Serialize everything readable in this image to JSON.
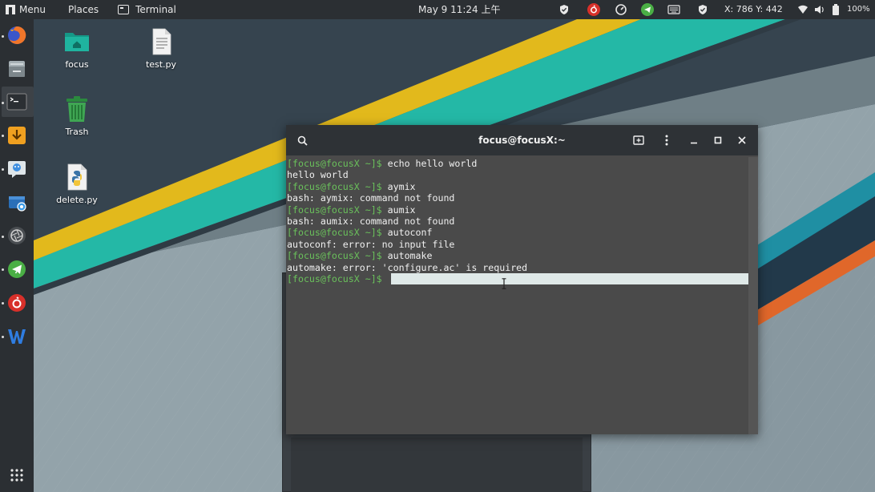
{
  "top_panel": {
    "menu_label": "Menu",
    "places_label": "Places",
    "terminal_label": "Terminal",
    "clock": "May 9  11:24 上午",
    "coords": "X: 786 Y: 442",
    "battery": "100%"
  },
  "desktop": {
    "icons": [
      {
        "label": "focus"
      },
      {
        "label": "test.py"
      },
      {
        "label": "Trash"
      },
      {
        "label": "delete.py"
      }
    ]
  },
  "terminal": {
    "title": "focus@focusX:~",
    "prompt": "[focus@focusX ~]$ ",
    "lines": [
      {
        "prompt": "[focus@focusX ~]$ ",
        "text": "echo hello world"
      },
      {
        "text": "hello world"
      },
      {
        "prompt": "[focus@focusX ~]$ ",
        "text": "aymix"
      },
      {
        "text": "bash: aymix: command not found"
      },
      {
        "prompt": "[focus@focusX ~]$ ",
        "text": "aumix"
      },
      {
        "text": "bash: aumix: command not found"
      },
      {
        "prompt": "[focus@focusX ~]$ ",
        "text": "autoconf"
      },
      {
        "text": "autoconf: error: no input file"
      },
      {
        "prompt": "[focus@focusX ~]$ ",
        "text": "automake"
      },
      {
        "text": "automake: error: 'configure.ac' is required"
      }
    ]
  },
  "colors": {
    "panel_bg": "#2b2f33",
    "prompt_green": "#6ac15b",
    "terminal_bg": "#4a4a4a",
    "stripe_yellow": "#e2b91c",
    "stripe_teal": "#24b8a6",
    "stripe_orange": "#e0672a"
  }
}
